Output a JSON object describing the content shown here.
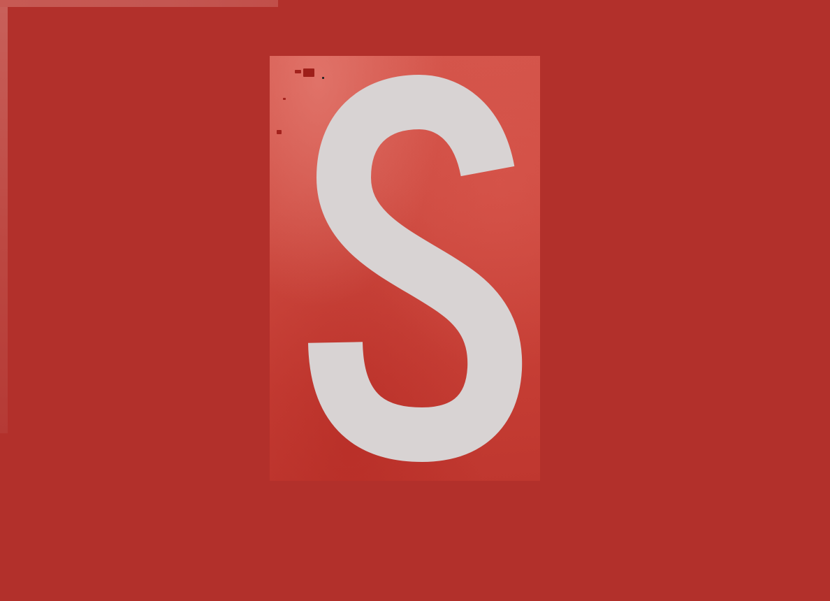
{
  "scene": {
    "background_color": "#b2302b",
    "sign_color": "#cd4a40",
    "letter_color": "#d8d3d3"
  },
  "sign": {
    "letter": "S"
  }
}
